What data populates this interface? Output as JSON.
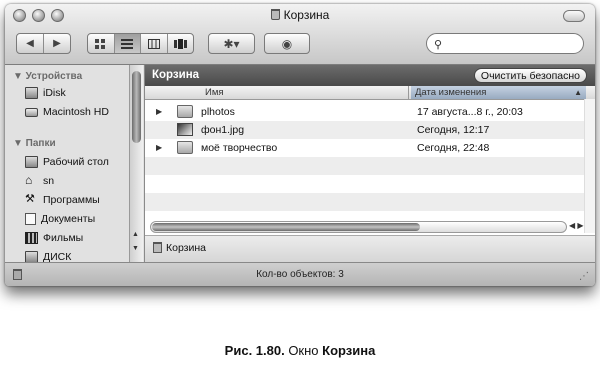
{
  "window": {
    "title": "Корзина",
    "search_placeholder": ""
  },
  "toolbar": {
    "nav_back": "◀",
    "nav_forward": "▶",
    "action_label": "✱▾",
    "eye_label": "◉"
  },
  "sidebar": {
    "groups": [
      {
        "label": "▼ Устройства",
        "items": [
          "iDisk",
          "Macintosh HD"
        ]
      },
      {
        "label": "▼ Папки",
        "items": [
          "Рабочий стол",
          "sn",
          "Программы",
          "Документы",
          "Фильмы",
          "ДИСК"
        ]
      }
    ]
  },
  "main": {
    "path_title": "Корзина",
    "empty_button": "Очистить безопасно",
    "columns": {
      "name": "Имя",
      "date": "Дата изменения"
    },
    "rows": [
      {
        "name": "plhotos",
        "date": "17 августа...8 г., 20:03",
        "expandable": true,
        "icon": "folder-icon"
      },
      {
        "name": "фон1.jpg",
        "date": "Сегодня, 12:17",
        "expandable": false,
        "icon": "image-file-icon"
      },
      {
        "name": "моё творчество",
        "date": "Сегодня, 22:48",
        "expandable": true,
        "icon": "folder-icon"
      }
    ],
    "path_strip": "Корзина"
  },
  "status": {
    "count_text": "Кол-во объектов: 3"
  },
  "caption": {
    "prefix": "Рис. 1.80.",
    "middle": " Окно ",
    "bold": "Корзина"
  }
}
